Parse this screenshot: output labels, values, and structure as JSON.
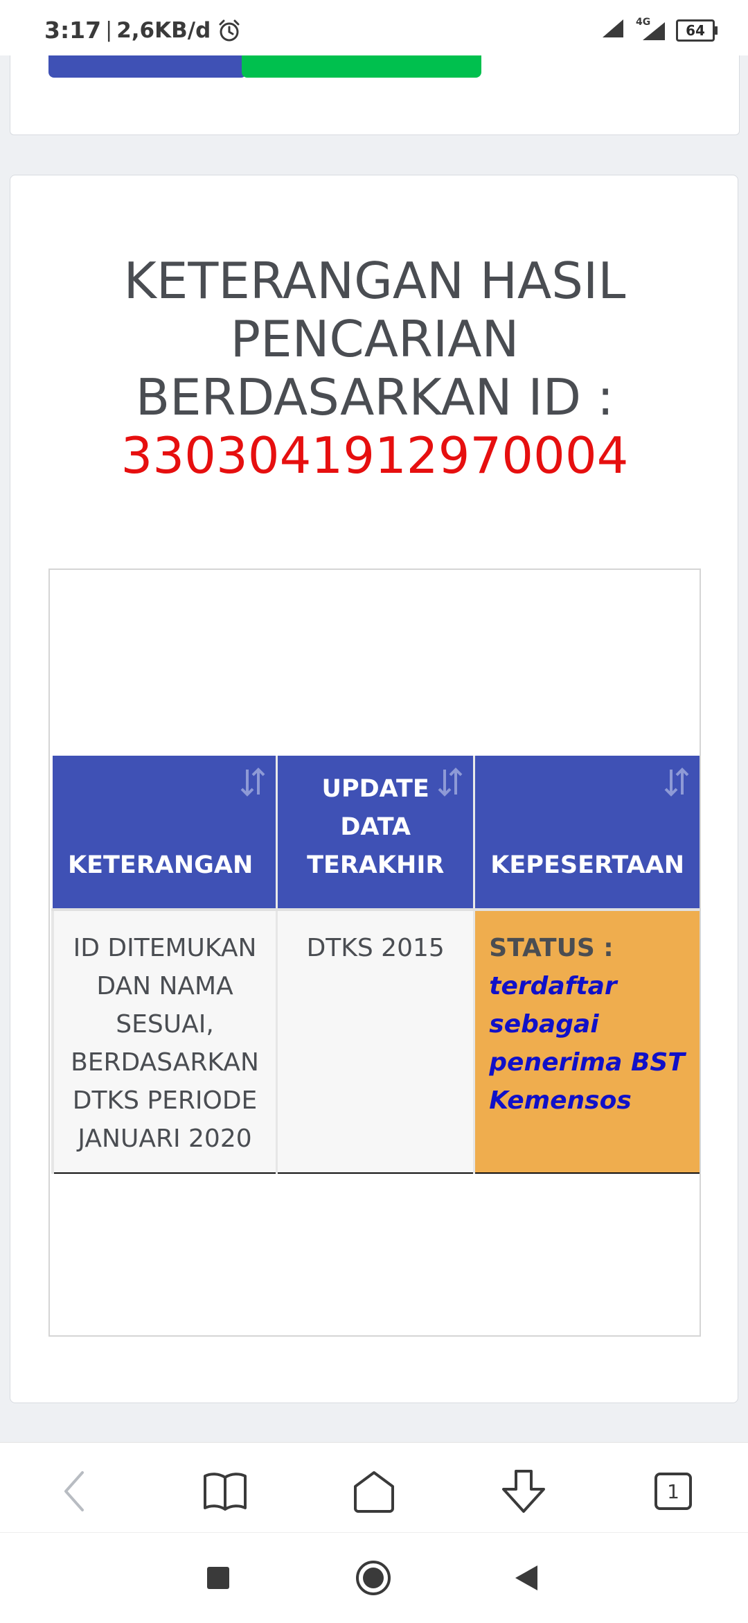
{
  "status_bar": {
    "time": "3:17",
    "separator": "|",
    "net_speed": "2,6KB/d",
    "network_type": "4G",
    "battery_level": "64"
  },
  "top_card": {
    "buttons": [
      {
        "color": "#3f51b5"
      },
      {
        "color": "#00c04e"
      }
    ]
  },
  "result": {
    "title": "KETERANGAN HASIL PENCARIAN BERDASARKAN ID :",
    "id_number": "3303041912970004",
    "title_color": "#4a4d52",
    "id_color": "#e60f0f"
  },
  "table": {
    "header_color": "#3f51b5",
    "columns": [
      {
        "label": "KETERANGAN"
      },
      {
        "label": "UPDATE DATA TERAKHIR"
      },
      {
        "label": "KEPESERTAAN"
      }
    ],
    "rows": [
      {
        "keterangan": "ID DITEMUKAN DAN NAMA SESUAI, BERDASARKAN DTKS PERIODE JANUARI 2020",
        "update_data": "DTKS 2015",
        "status_label": "STATUS :",
        "status_value": "terdaftar sebagai penerima BST Kemensos",
        "status_bg_color": "#efad4e",
        "status_value_color": "#1010c8"
      }
    ]
  },
  "browser_toolbar": {
    "tab_count": "1",
    "icons": [
      "back-icon",
      "bookmarks-icon",
      "home-icon",
      "download-icon",
      "tabs-icon"
    ]
  },
  "android_nav": {
    "icons": [
      "recents-icon",
      "home-circle-icon",
      "back-triangle-icon"
    ]
  }
}
